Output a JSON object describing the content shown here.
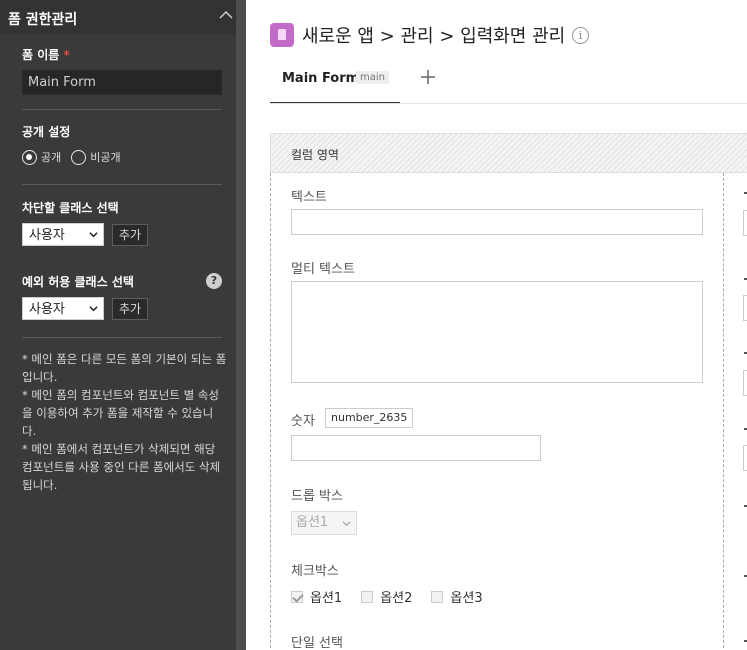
{
  "sidebar": {
    "title": "폼 권한관리",
    "form_name_label": "폼 이름",
    "required_mark": "*",
    "form_name_value": "Main Form",
    "visibility_label": "공개 설정",
    "visibility_options": [
      {
        "label": "공개",
        "checked": true
      },
      {
        "label": "비공개",
        "checked": false
      }
    ],
    "block_class_label": "차단할 클래스 선택",
    "block_class_value": "사용자",
    "block_add_label": "추가",
    "allow_class_label": "예외 허용 클래스 선택",
    "allow_class_value": "사용자",
    "allow_add_label": "추가",
    "help_glyph": "?",
    "notes": [
      "* 메인 폼은 다른 모든 폼의 기본이 되는 폼입니다.",
      "* 메인 폼의 컴포넌트와 컴포넌트 별 속성을 이용하여 추가 폼을 제작할 수 있습니다.",
      "* 메인 폼에서 컴포넌트가 삭제되면 해당 컴포넌트를 사용 중인 다른 폼에서도 삭제됩니다."
    ]
  },
  "header": {
    "breadcrumb": "새로운 앱 > 관리 > 입력화면 관리",
    "info_glyph": "i"
  },
  "tabs": [
    {
      "label": "Main Form",
      "badge": "main",
      "active": true
    }
  ],
  "main": {
    "column_area_label": "컬럼 영역",
    "fields": {
      "text_label": "텍스트",
      "multitext_label": "멀티 텍스트",
      "number_label": "숫자",
      "number_var": "number_2635",
      "dropdown_label": "드롭 박스",
      "dropdown_value": "옵션1",
      "checkbox_label": "체크박스",
      "checkbox_options": [
        {
          "label": "옵션1",
          "checked": true
        },
        {
          "label": "옵션2",
          "checked": false
        },
        {
          "label": "옵션3",
          "checked": false
        }
      ],
      "radio_label": "단일 선택"
    }
  },
  "colors": {
    "panel_bg": "#3a3a3a",
    "app_icon": "#c26bc9",
    "required": "#e24b4b"
  }
}
